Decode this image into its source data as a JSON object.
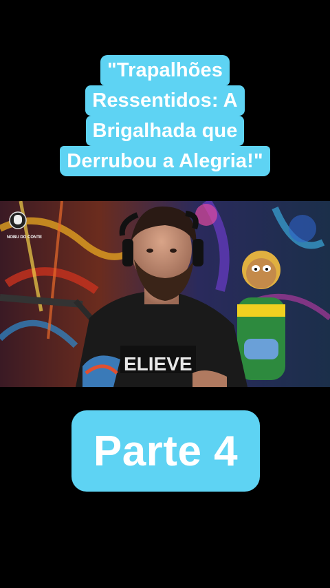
{
  "caption": {
    "lines": [
      "\"Trapalhões",
      "Ressentidos: A",
      "Brigalhada que",
      "Derrubou a Alegria!\""
    ]
  },
  "video": {
    "channel_logo_text": "NOBU DO CONTE",
    "shirt_text": "ELIEVE"
  },
  "badge": {
    "label": "Parte 4"
  },
  "colors": {
    "background": "#000000",
    "caption_bg": "#5ed3f3",
    "caption_text": "#ffffff"
  }
}
